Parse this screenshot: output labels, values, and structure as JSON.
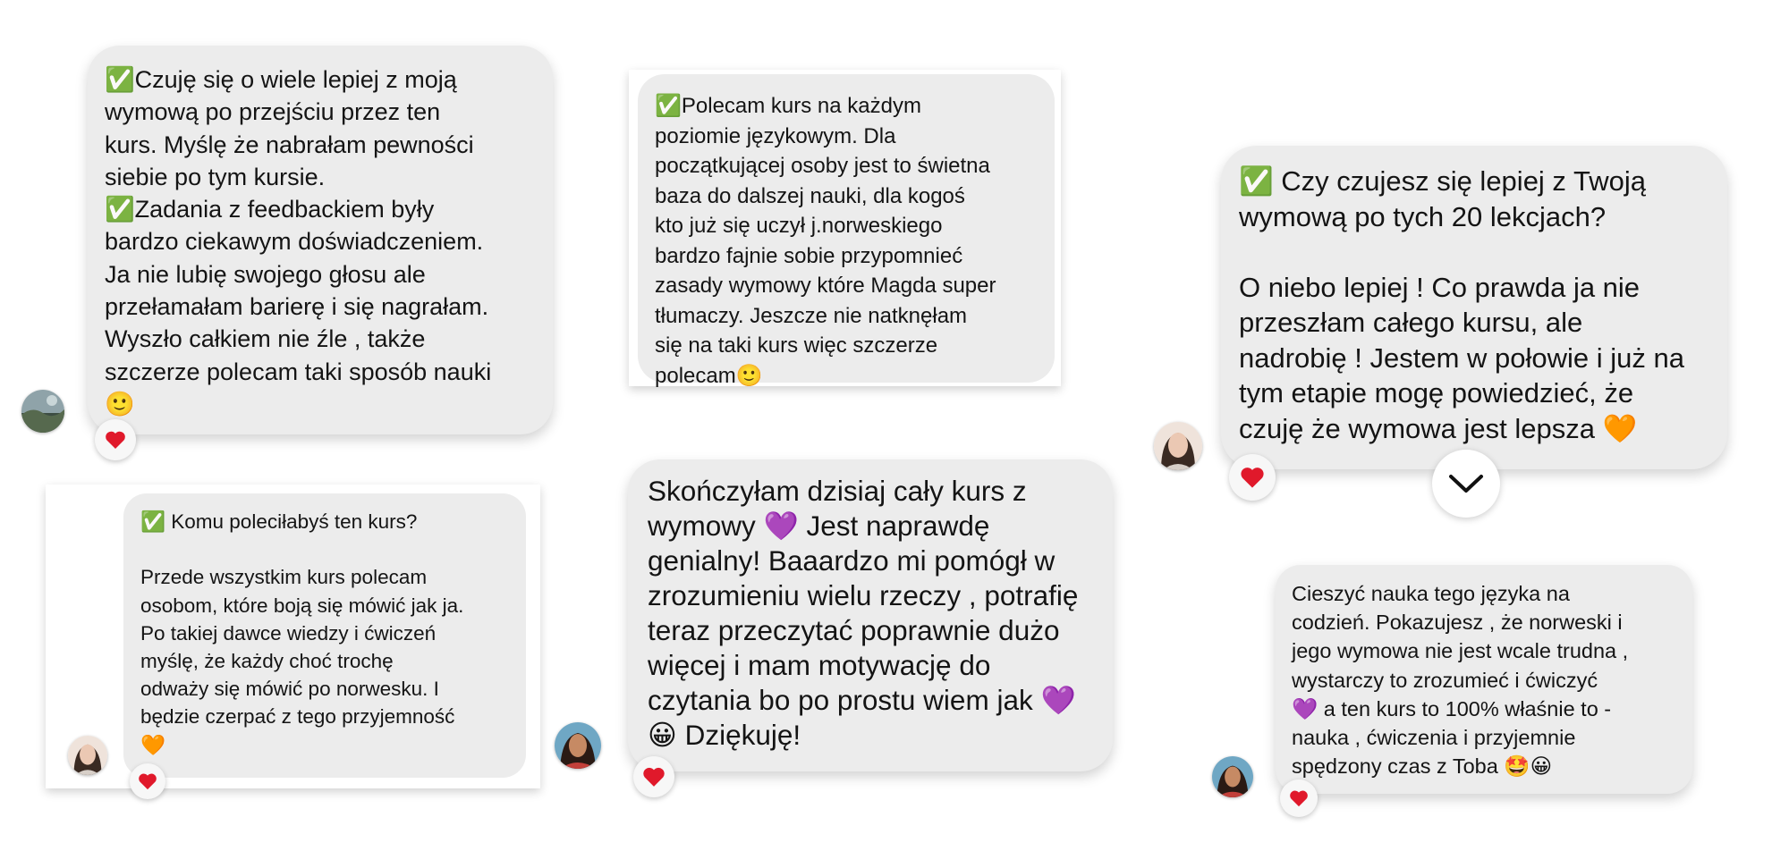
{
  "reviews": [
    {
      "text": "✅Czuję się o wiele lepiej z moją\nwymową po przejściu przez ten\nkurs. Myślę że nabrałam pewności\nsiebie po tym kursie.\n✅Zadania z feedbackiem były\nbardzo ciekawym doświadczeniem.\nJa nie lubię swojego głosu ale\nprzełamałam barierę i się nagrałam.\nWyszło całkiem nie źle , także\nszczerze polecam taki sposób nauki\n🙂"
    },
    {
      "text": "✅Polecam kurs na każdym\npoziomie językowym. Dla\npoczątkującej osoby jest to świetna\nbaza do dalszej nauki, dla  kogoś\nkto już się uczył j.norweskiego\nbardzo fajnie sobie przypomnieć\nzasady wymowy które Magda super\ntłumaczy. Jeszcze nie natknęłam\nsię na taki kurs więc szczerze\npolecam🙂"
    },
    {
      "text": "✅ Czy czujesz się lepiej z Twoją\nwymową po tych 20 lekcjach?\n\nO niebo lepiej ! Co prawda ja nie\nprzeszłam całego kursu, ale\nnadrobię ! Jestem w połowie i już na\ntym etapie mogę powiedzieć, że\nczuję że wymowa jest lepsza 🧡"
    },
    {
      "text": "✅ Komu poleciłabyś ten kurs?\n\nPrzede wszystkim kurs polecam\nosobom, które boją się mówić jak ja.\nPo takiej dawce wiedzy i ćwiczeń\nmyślę, że każdy choć trochę\nodważy się mówić po norwesku. I\nbędzie czerpać z tego przyjemność\n🧡"
    },
    {
      "text": "Skończyłam dzisiaj cały kurs z\nwymowy 💜 Jest naprawdę\ngenialny! Baaardzo mi pomógł w\nzrozumieniu wielu rzeczy , potrafię\nteraz przeczytać poprawnie dużo\nwięcej i mam motywację do\nczytania bo po prostu wiem jak 💜\n😀 Dziękuję!"
    },
    {
      "text": "Cieszyć nauka tego języka na\ncodzień. Pokazujesz , że norweski i\njego wymowa nie jest wcale trudna ,\nwystarczy to zrozumieć i ćwiczyć\n💜 a ten kurs to 100% właśnie to -\nnauka , ćwiczenia i przyjemnie\nspędzony czas z Toba 🤩😀"
    }
  ],
  "icons": {
    "reaction": "heart-icon",
    "scroll": "chevron-down-icon",
    "avatar": "avatar-photo"
  },
  "colors": {
    "bubble": "#ececec",
    "heart": "#e0192b"
  }
}
